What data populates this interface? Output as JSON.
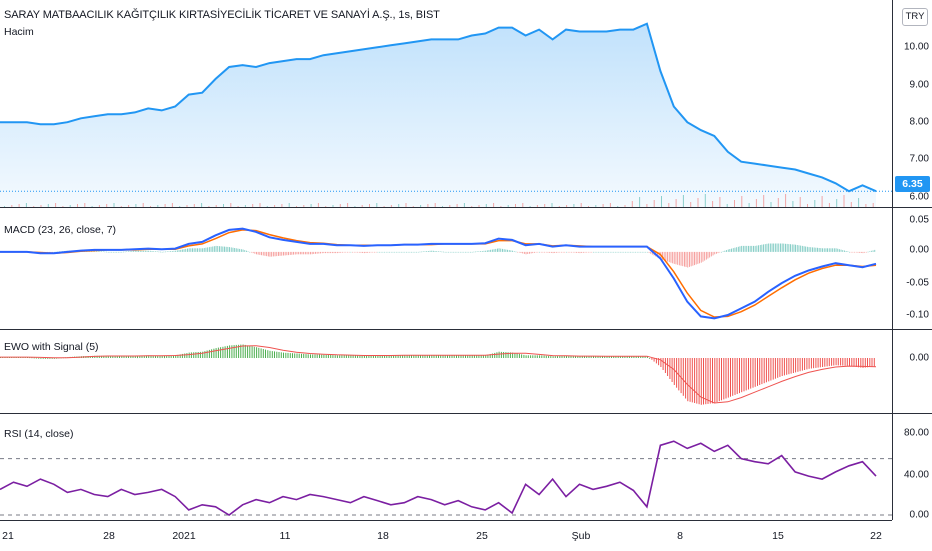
{
  "header": {
    "title": "SARAY MATBAACILIK KAĞITÇILIK KIRTASİYECİLİK TİCARET VE SANAYİ A.Ş., 1s, BIST",
    "volume_label": "Hacim",
    "currency_button": "TRY",
    "last_price": "6.35"
  },
  "panes": {
    "price": {
      "ticks": [
        "10.00",
        "9.00",
        "8.00",
        "7.00",
        "6.00"
      ]
    },
    "macd": {
      "label": "MACD (23, 26, close, 7)",
      "ticks": [
        "0.05",
        "0.00",
        "-0.05",
        "-0.10"
      ]
    },
    "ewo": {
      "label": "EWO with Signal (5)",
      "ticks": [
        "0.00"
      ]
    },
    "rsi": {
      "label": "RSI (14, close)",
      "ticks": [
        "80.00",
        "40.00",
        "0.00"
      ]
    }
  },
  "xaxis": {
    "labels": [
      "21",
      "28",
      "2021",
      "11",
      "18",
      "25",
      "Şub",
      "8",
      "15",
      "22"
    ]
  },
  "colors": {
    "price_line": "#2196f3",
    "macd_line": "#2962ff",
    "signal_line": "#ff6d00",
    "rsi_line": "#7b1fa2",
    "up": "#26a69a",
    "down": "#ef5350",
    "ewo_up": "#4caf50"
  },
  "chart_data": [
    {
      "type": "line",
      "title": "SARAY MATBAACILIK KAĞITÇILIK KIRTASİYECİLİK TİCARET VE SANAYİ A.Ş., 1s, BIST",
      "ylim": [
        5.9,
        11.0
      ],
      "series": [
        {
          "values": [
            8.1,
            8.1,
            8.1,
            8.05,
            8.05,
            8.1,
            8.2,
            8.25,
            8.3,
            8.3,
            8.35,
            8.45,
            8.4,
            8.5,
            8.8,
            8.85,
            9.2,
            9.5,
            9.55,
            9.5,
            9.6,
            9.65,
            9.7,
            9.7,
            9.8,
            9.85,
            9.9,
            9.95,
            10.0,
            10.05,
            10.1,
            10.15,
            10.2,
            10.2,
            10.2,
            10.3,
            10.35,
            10.5,
            10.5,
            10.3,
            10.45,
            10.2,
            10.45,
            10.4,
            10.4,
            10.4,
            10.45,
            10.45,
            10.6,
            9.4,
            8.5,
            8.1,
            7.9,
            7.75,
            7.35,
            7.1,
            7.05,
            7.0,
            6.95,
            6.9,
            6.8,
            6.7,
            6.55,
            6.35,
            6.5,
            6.35
          ]
        }
      ]
    },
    {
      "type": "line",
      "title": "MACD (23, 26, close, 7)",
      "ylim": [
        -0.11,
        0.06
      ],
      "series": [
        {
          "values": [
            0.0,
            0.0,
            0.0,
            -0.002,
            -0.002,
            0.0,
            0.002,
            0.003,
            0.003,
            0.003,
            0.004,
            0.005,
            0.004,
            0.005,
            0.012,
            0.015,
            0.025,
            0.033,
            0.035,
            0.03,
            0.022,
            0.018,
            0.015,
            0.012,
            0.012,
            0.01,
            0.01,
            0.009,
            0.01,
            0.01,
            0.011,
            0.011,
            0.012,
            0.012,
            0.012,
            0.012,
            0.013,
            0.02,
            0.018,
            0.01,
            0.012,
            0.008,
            0.01,
            0.008,
            0.008,
            0.008,
            0.008,
            0.008,
            0.008,
            -0.01,
            -0.04,
            -0.075,
            -0.097,
            -0.1,
            -0.095,
            -0.085,
            -0.075,
            -0.06,
            -0.047,
            -0.036,
            -0.028,
            -0.022,
            -0.017,
            -0.02,
            -0.023,
            -0.018
          ]
        },
        {
          "values": [
            0.0,
            0.0,
            0.0,
            -0.001,
            -0.002,
            -0.001,
            0.001,
            0.002,
            0.003,
            0.003,
            0.003,
            0.004,
            0.004,
            0.004,
            0.009,
            0.012,
            0.02,
            0.029,
            0.033,
            0.032,
            0.026,
            0.021,
            0.017,
            0.014,
            0.013,
            0.011,
            0.01,
            0.01,
            0.01,
            0.01,
            0.011,
            0.011,
            0.011,
            0.012,
            0.012,
            0.012,
            0.012,
            0.017,
            0.017,
            0.012,
            0.012,
            0.009,
            0.01,
            0.009,
            0.008,
            0.008,
            0.008,
            0.008,
            0.008,
            -0.004,
            -0.03,
            -0.062,
            -0.088,
            -0.098,
            -0.097,
            -0.09,
            -0.08,
            -0.067,
            -0.054,
            -0.042,
            -0.032,
            -0.025,
            -0.02,
            -0.02,
            -0.022,
            -0.02
          ]
        }
      ]
    },
    {
      "type": "bar",
      "title": "EWO with Signal (5)",
      "series": [
        {
          "values": [
            0.05,
            0.05,
            0.05,
            0.0,
            0.0,
            0.05,
            0.1,
            0.12,
            0.12,
            0.1,
            0.12,
            0.15,
            0.12,
            0.15,
            0.3,
            0.35,
            0.55,
            0.7,
            0.75,
            0.6,
            0.4,
            0.3,
            0.25,
            0.2,
            0.18,
            0.15,
            0.15,
            0.12,
            0.15,
            0.15,
            0.15,
            0.15,
            0.15,
            0.15,
            0.15,
            0.15,
            0.15,
            0.35,
            0.3,
            0.15,
            0.15,
            0.1,
            0.12,
            0.1,
            0.1,
            0.1,
            0.1,
            0.1,
            0.1,
            -0.5,
            -1.5,
            -2.4,
            -2.6,
            -2.5,
            -2.2,
            -1.9,
            -1.6,
            -1.3,
            -1.0,
            -0.8,
            -0.6,
            -0.5,
            -0.4,
            -0.45,
            -0.55,
            -0.45
          ]
        }
      ]
    },
    {
      "type": "line",
      "title": "RSI (14, close)",
      "ylim": [
        0,
        90
      ],
      "series": [
        {
          "values": [
            55,
            48,
            52,
            45,
            50,
            58,
            55,
            60,
            62,
            55,
            60,
            58,
            55,
            62,
            75,
            70,
            72,
            80,
            70,
            65,
            68,
            62,
            65,
            60,
            62,
            65,
            68,
            62,
            66,
            70,
            68,
            62,
            65,
            70,
            66,
            72,
            75,
            68,
            78,
            50,
            60,
            45,
            62,
            50,
            55,
            52,
            48,
            56,
            72,
            12,
            8,
            15,
            10,
            18,
            12,
            25,
            28,
            30,
            22,
            38,
            42,
            45,
            38,
            32,
            28,
            42
          ]
        }
      ]
    }
  ]
}
